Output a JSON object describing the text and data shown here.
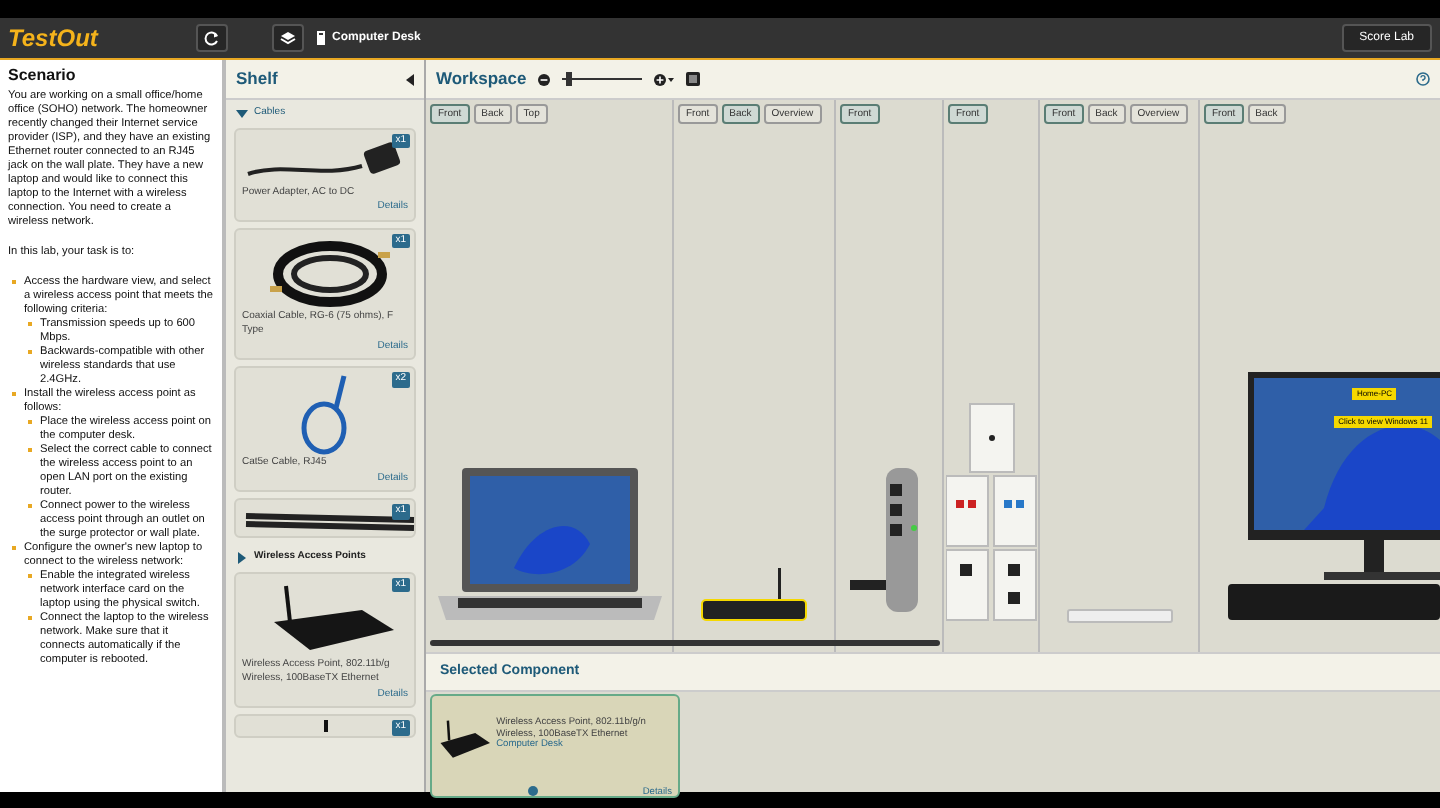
{
  "header": {
    "logo": "TestOut",
    "breadcrumb": "Computer Desk",
    "score_button": "Score Lab"
  },
  "scenario": {
    "title": "Scenario",
    "intro": "You are working on a small office/home office (SOHO) network. The homeowner recently changed their Internet service provider (ISP), and they have an existing Ethernet router connected to an RJ45 jack on the wall plate. They have a new laptop and would like to connect this laptop to the Internet with a wireless connection. You need to create a wireless network.",
    "task_intro": "In this lab, your task is to:",
    "tasks": [
      {
        "text": "Access the hardware view, and select a wireless access point that meets the following criteria:",
        "children": [
          {
            "text": "Transmission speeds up to 600 Mbps."
          },
          {
            "text": "Backwards-compatible with other wireless standards that use 2.4GHz."
          }
        ]
      },
      {
        "text": "Install the wireless access point as follows:",
        "children": [
          {
            "text": "Place the wireless access point on the computer desk."
          },
          {
            "text": "Select the correct cable to connect the wireless access point to an open LAN port on the existing router."
          },
          {
            "text": "Connect power to the wireless access point through an outlet on the surge protector or wall plate."
          }
        ]
      },
      {
        "text": "Configure the owner's new laptop to connect to the wireless network:",
        "children": [
          {
            "text": "Enable the integrated wireless network interface card on the laptop using the physical switch."
          },
          {
            "text": "Connect the laptop to the wireless network. Make sure that it connects automatically if the computer is rebooted."
          }
        ]
      }
    ]
  },
  "shelf": {
    "title": "Shelf",
    "categories": [
      {
        "name": "Cables",
        "expanded": true,
        "items": [
          {
            "kind": "adapter",
            "name": "Power Adapter, AC to DC",
            "count": "x1",
            "details": "Details"
          },
          {
            "kind": "coax",
            "name": "Coaxial Cable, RG-6 (75 ohms), F Type",
            "count": "x1",
            "details": "Details"
          },
          {
            "kind": "cat5",
            "name": "Cat5e Cable, RJ45",
            "count": "x2",
            "details": "Details"
          },
          {
            "kind": "flatcable",
            "count": "x1"
          }
        ]
      },
      {
        "name": "Wireless Access Points",
        "expanded": false,
        "items": [
          {
            "kind": "wap",
            "name": "Wireless Access Point, 802.11b/g Wireless, 100BaseTX Ethernet",
            "count": "x1",
            "details": "Details"
          },
          {
            "kind": "wap2",
            "count": "x1"
          }
        ]
      }
    ]
  },
  "workspace": {
    "title": "Workspace",
    "zoom": {
      "level": 0.05
    },
    "columns": [
      {
        "kind": "laptop",
        "views": [
          {
            "label": "Front",
            "selected": true
          },
          {
            "label": "Back",
            "selected": false
          },
          {
            "label": "Top",
            "selected": false
          }
        ]
      },
      {
        "kind": "wap",
        "views": [
          {
            "label": "Front",
            "selected": false
          },
          {
            "label": "Back",
            "selected": true
          },
          {
            "label": "Overview",
            "selected": false
          }
        ]
      },
      {
        "kind": "surge",
        "views": [
          {
            "label": "Front",
            "selected": true
          }
        ]
      },
      {
        "kind": "wallplate",
        "views": [
          {
            "label": "Front",
            "selected": true
          }
        ]
      },
      {
        "kind": "strip",
        "views": [
          {
            "label": "Front",
            "selected": true
          },
          {
            "label": "Back",
            "selected": false
          },
          {
            "label": "Overview",
            "selected": false
          }
        ]
      },
      {
        "kind": "desktop",
        "screen_labels": [
          "Home-PC",
          "Click to view Windows 11"
        ],
        "views": [
          {
            "label": "Front",
            "selected": true
          },
          {
            "label": "Back",
            "selected": false
          }
        ]
      }
    ]
  },
  "selected_component": {
    "title": "Selected Component",
    "name": "Wireless Access Point, 802.11b/g/n Wireless, 100BaseTX Ethernet",
    "location": "Computer Desk",
    "details": "Details"
  }
}
